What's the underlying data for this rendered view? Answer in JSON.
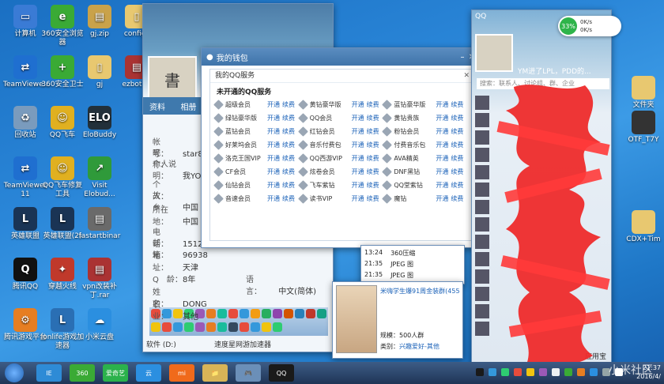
{
  "desktop_icons": [
    {
      "label": "计算机",
      "color": "#3a7bd5",
      "glyph": "▭",
      "col": 0,
      "row": 0
    },
    {
      "label": "360安全浏览器",
      "color": "#3aaa35",
      "glyph": "e",
      "col": 1,
      "row": 0
    },
    {
      "label": "gj.zip",
      "color": "#c9a24a",
      "glyph": "▤",
      "col": 2,
      "row": 0
    },
    {
      "label": "configs",
      "color": "#e8c870",
      "glyph": "▯",
      "col": 3,
      "row": 0
    },
    {
      "label": "TeamViewe...",
      "color": "#1f6fd0",
      "glyph": "⇄",
      "col": 0,
      "row": 1
    },
    {
      "label": "360安全卫士",
      "color": "#3aaa35",
      "glyph": "+",
      "col": 1,
      "row": 1
    },
    {
      "label": "gj",
      "color": "#e8c870",
      "glyph": "▯",
      "col": 2,
      "row": 1
    },
    {
      "label": "ezbot.ra",
      "color": "#a33",
      "glyph": "▤",
      "col": 3,
      "row": 1
    },
    {
      "label": "回收站",
      "color": "#7a9bbd",
      "glyph": "♻",
      "col": 0,
      "row": 2
    },
    {
      "label": "QQ飞车",
      "color": "#e0b020",
      "glyph": "☺",
      "col": 1,
      "row": 2
    },
    {
      "label": "EloBuddy",
      "color": "#22303a",
      "glyph": "ELO",
      "col": 2,
      "row": 2
    },
    {
      "label": "TeamViewer 11",
      "color": "#1f6fd0",
      "glyph": "⇄",
      "col": 0,
      "row": 3
    },
    {
      "label": "QQ飞车修复工具",
      "color": "#e0b020",
      "glyph": "☺",
      "col": 1,
      "row": 3
    },
    {
      "label": "Visit Elobud...",
      "color": "#2f9a3a",
      "glyph": "↗",
      "col": 2,
      "row": 3
    },
    {
      "label": "英雄联盟",
      "color": "#1a3455",
      "glyph": "L",
      "col": 0,
      "row": 4
    },
    {
      "label": "英雄联盟(2)",
      "color": "#1a3455",
      "glyph": "L",
      "col": 1,
      "row": 4
    },
    {
      "label": "fastartbinar",
      "color": "#6a6a6a",
      "glyph": "▤",
      "col": 2,
      "row": 4
    },
    {
      "label": "腾讯QQ",
      "color": "#111",
      "glyph": "Q",
      "col": 0,
      "row": 5
    },
    {
      "label": "穿越火线",
      "color": "#c0392b",
      "glyph": "✦",
      "col": 1,
      "row": 5
    },
    {
      "label": "vpn改装补丁.rar",
      "color": "#a33",
      "glyph": "▤",
      "col": 2,
      "row": 5
    },
    {
      "label": "腾讯游戏平台",
      "color": "#e67e22",
      "glyph": "⚙",
      "col": 0,
      "row": 6
    },
    {
      "label": "lonlife游戏加速器",
      "color": "#2a6fb4",
      "glyph": "L",
      "col": 1,
      "row": 6
    },
    {
      "label": "小米云盘",
      "color": "#2b8fe0",
      "glyph": "☁",
      "col": 2,
      "row": 6
    }
  ],
  "right_icons": [
    {
      "label": "文件夹",
      "color": "#e8c870"
    },
    {
      "label": "OTF_T7Y",
      "color": "#333"
    },
    {
      "label": "CDX+Tim",
      "color": "#e8c870"
    }
  ],
  "profile": {
    "tabs": [
      "资料",
      "相册"
    ],
    "fields": [
      {
        "label": "帐　号：",
        "value": "star87"
      },
      {
        "label": "昵　称：",
        "value": ""
      },
      {
        "label": "个人说明：",
        "value": "我YO"
      },
      {
        "label": "个　人：",
        "value": ""
      },
      {
        "label": "故　乡：",
        "value": "中国"
      },
      {
        "label": "所在地：",
        "value": "中国"
      },
      {
        "label": "电　话：",
        "value": "15122"
      },
      {
        "label": "邮　箱：",
        "value": "96938"
      },
      {
        "label": "地　址：",
        "value": "天津"
      },
      {
        "label": "Q　龄：",
        "value": "8年"
      },
      {
        "label": "姓　名：",
        "value": "DONG"
      },
      {
        "label": "职　业：",
        "value": "其他"
      }
    ],
    "language_label": "语　言：",
    "language_value": "中文(简体)",
    "toolbar_icon_colors": [
      "#e74c3c",
      "#3498db",
      "#f1c40f",
      "#2ecc71",
      "#9b59b6",
      "#e67e22",
      "#1abc9c",
      "#e74c3c",
      "#3498db",
      "#f39c12",
      "#27ae60",
      "#8e44ad",
      "#d35400",
      "#2980b9",
      "#c0392b",
      "#16a085",
      "#f1c40f",
      "#e74c3c",
      "#3498db",
      "#2ecc71",
      "#9b59b6",
      "#e67e22",
      "#1abc9c",
      "#34495e",
      "#e74c3c",
      "#3498db",
      "#f1c40f",
      "#2ecc71"
    ],
    "bottom_items": [
      "软件 (D:)",
      "速度星网游加速器"
    ]
  },
  "services": {
    "window_title": "我的钱包",
    "panel_title": "我的QQ服务",
    "section_title": "未开通的QQ服务",
    "open_label": "开通",
    "renew_label": "续费",
    "items": [
      "超级会员",
      "绿钻豪华版",
      "蓝钻会员",
      "好莱坞会员",
      "洛克王国VIP",
      "CF会员",
      "仙钻会员",
      "音速会员",
      "黄钻豪华版",
      "QQ会员",
      "红钻会员",
      "音乐付费包",
      "QQ西游VIP",
      "炫卷会员",
      "飞车紫钻",
      "读书VIP",
      "蓝钻豪华版",
      "黄钻贵族",
      "粉钻会员",
      "付费音乐包",
      "AVA精英",
      "DNF黑钻",
      "QQ堂紫钻",
      "魔钻"
    ]
  },
  "qq": {
    "title": "QQ",
    "nickname": "YM进了LPL，PDD的...",
    "search_placeholder": "搜索：联系人、讨论组、群、企业",
    "bottom_label": "应用宝"
  },
  "speed": {
    "percent": "33%",
    "up": "0K/s",
    "down": "0K/s"
  },
  "group_popup": {
    "title": "米嗨学生爆91周金装群(4555...",
    "size_label": "规模：500人群",
    "category_label": "类别：",
    "category_value": "兴趣爱好-其他"
  },
  "explorer": {
    "rows": [
      {
        "time": "13:24",
        "name": "360压缩"
      },
      {
        "time": "21:35",
        "name": "JPEG 图"
      },
      {
        "time": "21:35",
        "name": "JPEG 图"
      }
    ]
  },
  "taskbar": {
    "buttons": [
      {
        "label": "IE",
        "color": "#2e8bd6"
      },
      {
        "label": "360",
        "color": "#3aaa35"
      },
      {
        "label": "爱奇艺",
        "color": "#2bb24c"
      },
      {
        "label": "云",
        "color": "#2b8fe0"
      },
      {
        "label": "mi",
        "color": "#f06a1b"
      },
      {
        "label": "📁",
        "color": "#d8b457"
      },
      {
        "label": "🎮",
        "color": "#6b8fb8"
      },
      {
        "label": "QQ",
        "color": "#1a1a1a"
      }
    ],
    "time": "21:37",
    "date": "2016/4/"
  },
  "watermark": "小米社区"
}
